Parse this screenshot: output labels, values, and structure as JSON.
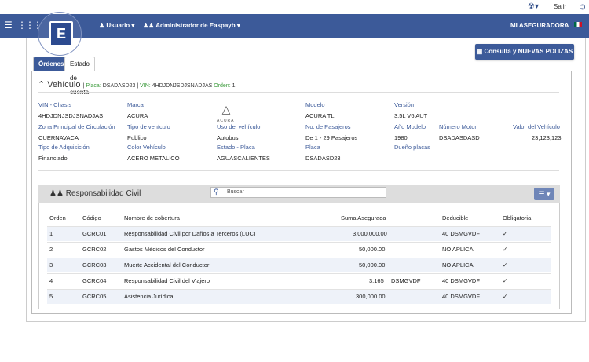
{
  "topbar": {
    "salir": "Salir"
  },
  "navbar": {
    "usuario": "Usuario",
    "admin": "Administrador de Easpayb",
    "aseguradora": "MI ASEGURADORA"
  },
  "consulta_button": "Consulta y NUEVAS POLIZAS",
  "tabs": [
    {
      "label": "Órdenes"
    },
    {
      "label": "Estado de cuenta"
    }
  ],
  "vehiculo": {
    "title": "Vehículo",
    "placa_label": "Placa:",
    "placa_value": "DSADASD23",
    "vin_label": "VIN:",
    "vin_value": "4HDJDNJSDJSNADJAS",
    "orden_label": "Orden:",
    "orden_value": "1",
    "brand_logo_text": "ACURA",
    "fields": [
      {
        "label": "VIN - Chasis",
        "value": "4HDJDNJSDJSNADJAS"
      },
      {
        "label": "Marca",
        "value": "ACURA"
      },
      {
        "label": "Modelo",
        "value": "ACURA TL"
      },
      {
        "label": "Versión",
        "value": "3.5L V6 AUT"
      },
      {
        "label": "Zona Principal de Circulación",
        "value": "CUERNAVACA"
      },
      {
        "label": "Tipo de vehículo",
        "value": "Publico"
      },
      {
        "label": "Uso del vehículo",
        "value": "Autobus"
      },
      {
        "label": "No. de Pasajeros",
        "value": "De 1 - 29 Pasajeros"
      },
      {
        "label": "Año Modelo",
        "value": "1980"
      },
      {
        "label": "Número Motor",
        "value": "DSADASDASD"
      },
      {
        "label": "Valor del Vehículo",
        "value": "23,123,123"
      },
      {
        "label": "Tipo de Adquisición",
        "value": "Financiado"
      },
      {
        "label": "Color Vehículo",
        "value": "ACERO METALICO"
      },
      {
        "label": "Estado - Placa",
        "value": "AGUASCALIENTES"
      },
      {
        "label": "Placa",
        "value": "DSADASD23"
      },
      {
        "label": "Dueño placas",
        "value": ""
      }
    ]
  },
  "responsabilidad": {
    "title": "Responsabilidad Civil",
    "search_placeholder": "Buscar",
    "columns": [
      "Orden",
      "Código",
      "Nombre de cobertura",
      "Suma Asegurada",
      "Deducible",
      "Obligatoria"
    ],
    "rows": [
      {
        "orden": "1",
        "codigo": "GCRC01",
        "nombre": "Responsabilidad Civil por Daños a Terceros (LUC)",
        "suma": "3,000,000.00",
        "unidad": "",
        "deducible": "40 DSMGVDF",
        "obligatoria": "✓"
      },
      {
        "orden": "2",
        "codigo": "GCRC02",
        "nombre": "Gastos Médicos del Conductor",
        "suma": "50,000.00",
        "unidad": "",
        "deducible": "NO APLICA",
        "obligatoria": "✓"
      },
      {
        "orden": "3",
        "codigo": "GCRC03",
        "nombre": "Muerte Accidental del Conductor",
        "suma": "50,000.00",
        "unidad": "",
        "deducible": "NO APLICA",
        "obligatoria": "✓"
      },
      {
        "orden": "4",
        "codigo": "GCRC04",
        "nombre": "Responsabilidad Civil del Viajero",
        "suma": "3,165",
        "unidad": "DSMGVDF",
        "deducible": "40 DSMGVDF",
        "obligatoria": "✓"
      },
      {
        "orden": "5",
        "codigo": "GCRC05",
        "nombre": "Asistencia Jurídica",
        "suma": "300,000.00",
        "unidad": "",
        "deducible": "40 DSMGVDF",
        "obligatoria": "✓"
      }
    ]
  }
}
